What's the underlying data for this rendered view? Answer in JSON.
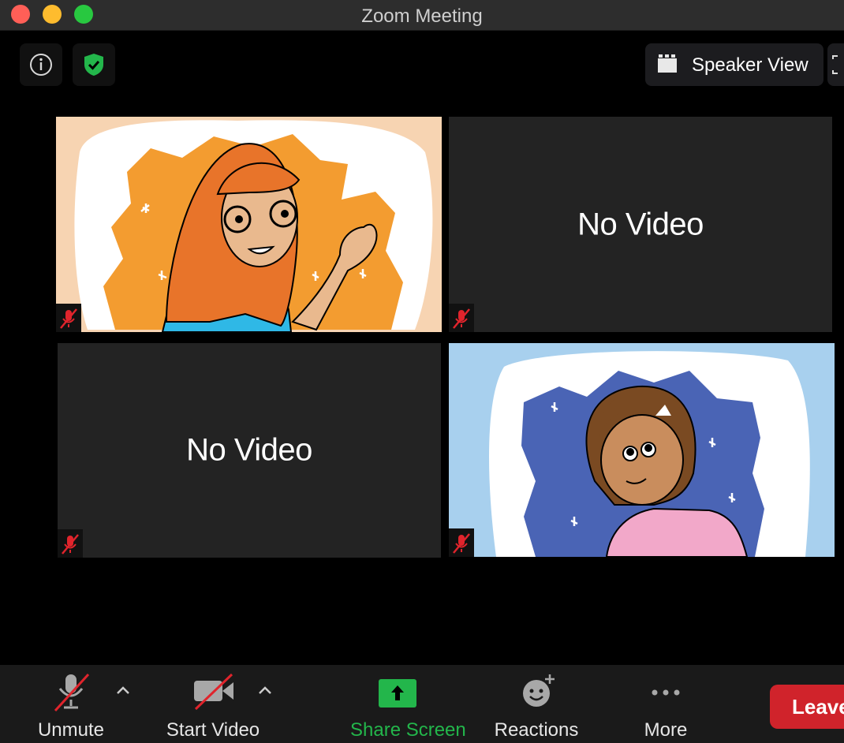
{
  "window": {
    "title": "Zoom Meeting"
  },
  "header": {
    "view_button_label": "Speaker View"
  },
  "tiles": [
    {
      "type": "avatar"
    },
    {
      "type": "no-video",
      "label": "No Video"
    },
    {
      "type": "no-video",
      "label": "No Video"
    },
    {
      "type": "avatar"
    }
  ],
  "toolbar": {
    "unmute_label": "Unmute",
    "start_video_label": "Start Video",
    "share_screen_label": "Share Screen",
    "reactions_label": "Reactions",
    "more_label": "More",
    "leave_label": "Leave"
  },
  "colors": {
    "close": "#ff5f57",
    "minimize": "#febc2e",
    "zoom": "#28c840",
    "share_green": "#23b64b",
    "leave_red": "#d0232b",
    "mute_red": "#e0242c"
  },
  "icons": [
    "info-icon",
    "shield-check-icon",
    "grid-icon",
    "fullscreen-icon",
    "mic-muted-icon",
    "video-off-icon",
    "share-arrow-icon",
    "reactions-icon",
    "more-icon",
    "caret-up-icon"
  ]
}
